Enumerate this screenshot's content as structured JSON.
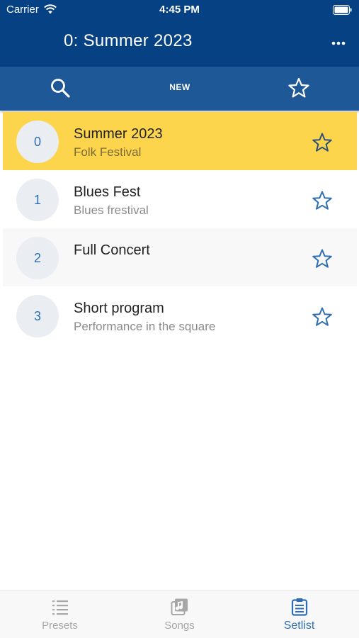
{
  "status_bar": {
    "carrier": "Carrier",
    "time": "4:45 PM"
  },
  "nav": {
    "title": "0: Summer 2023",
    "more_icon": "more-horizontal-icon"
  },
  "toolbar": {
    "search_icon": "search-icon",
    "new_label": "NEW",
    "favorites_icon": "star-icon"
  },
  "setlists": [
    {
      "number": "0",
      "title": "Summer 2023",
      "subtitle": "Folk Festival",
      "selected": true
    },
    {
      "number": "1",
      "title": "Blues Fest",
      "subtitle": "Blues frestival",
      "selected": false
    },
    {
      "number": "2",
      "title": "Full Concert",
      "subtitle": "",
      "selected": false
    },
    {
      "number": "3",
      "title": "Short program",
      "subtitle": "Performance in the square",
      "selected": false
    }
  ],
  "tabs": [
    {
      "label": "Presets",
      "icon": "list-icon",
      "active": false
    },
    {
      "label": "Songs",
      "icon": "music-library-icon",
      "active": false
    },
    {
      "label": "Setlist",
      "icon": "clipboard-icon",
      "active": true
    }
  ],
  "colors": {
    "nav_bg": "#064183",
    "toolbar_bg": "#1f5896",
    "selected_row": "#fdd54c",
    "accent": "#2f6eb0"
  }
}
